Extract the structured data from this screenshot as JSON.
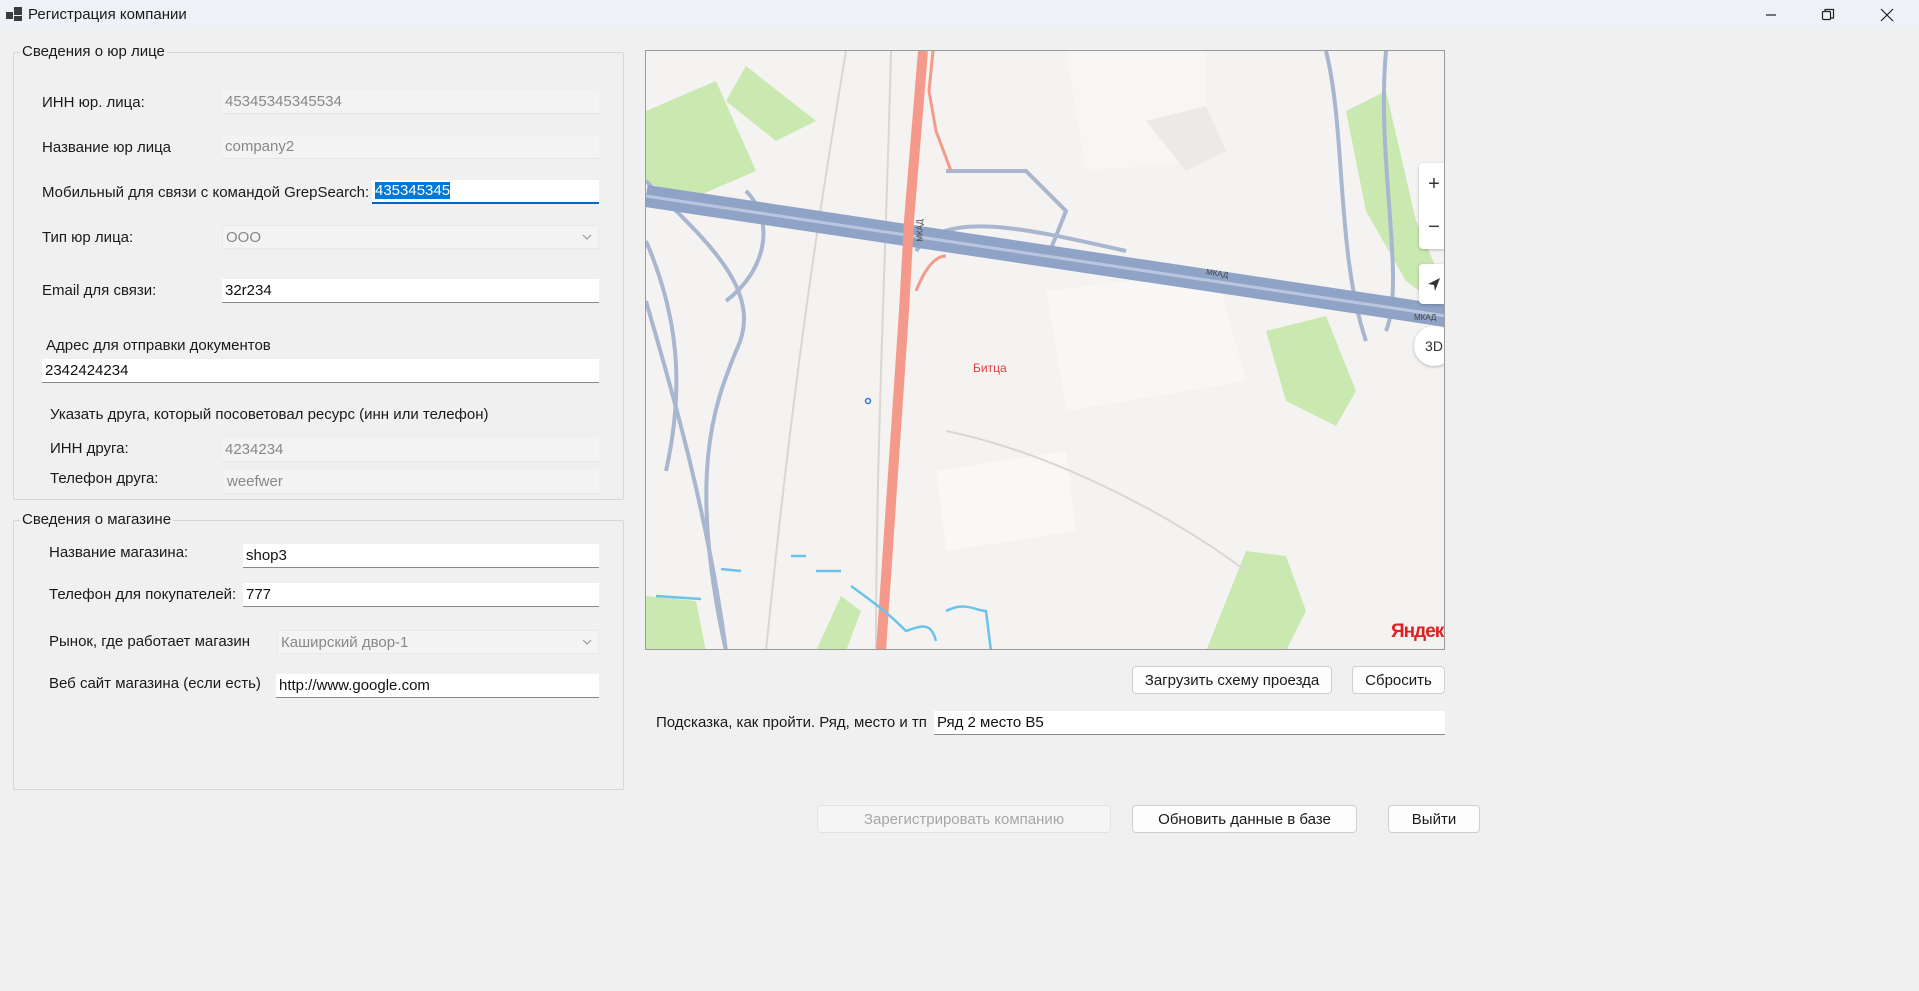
{
  "window": {
    "title": "Регистрация компании",
    "controls": [
      "minimize",
      "restore",
      "close"
    ]
  },
  "legal": {
    "group_title": "Сведения о юр лице",
    "inn_label": "ИНН юр. лица:",
    "inn_value": "45345345345534",
    "name_label": "Название юр лица",
    "name_value": "company2",
    "mobile_label": "Мобильный для связи с командой GrepSearch:",
    "mobile_value": "435345345",
    "type_label": "Тип юр лица:",
    "type_value": "ООО",
    "email_label": "Email для связи:",
    "email_value": "32r234",
    "address_label": "Адрес для отправки документов",
    "address_value": "2342424234",
    "friend_hint": "Указать друга, который посоветовал ресурс (инн или телефон)",
    "friend_inn_label": "ИНН друга:",
    "friend_inn_value": "4234234",
    "friend_phone_label": "Телефон друга:",
    "friend_phone_value": "weefwer"
  },
  "shop": {
    "group_title": "Сведения о магазине",
    "name_label": "Название магазина:",
    "name_value": "shop3",
    "phone_label": "Телефон для покупателей:",
    "phone_value": "777",
    "market_label": "Рынок, где работает магазин",
    "market_value": "Каширский двор-1",
    "site_label": "Веб сайт магазина (если есть)",
    "site_value": "http://www.google.com"
  },
  "map": {
    "place_label": "Битца",
    "road_label_1": "МКАД",
    "road_label_2": "МКАД",
    "road_label_3": "МКАД",
    "zoom_in": "+",
    "zoom_out": "−",
    "mode_3d": "3D",
    "provider_logo": "Яндекс",
    "colors": {
      "ground": "#f4f3f1",
      "park": "#c9e9b0",
      "highway": "#8fa3c7",
      "main_road": "#f59a8a",
      "water": "#6cc3ea"
    }
  },
  "map_actions": {
    "upload_label": "Загрузить схему проезда",
    "reset_label": "Сбросить",
    "hint_label": "Подсказка, как пройти. Ряд, место и тп",
    "hint_value": "Ряд 2 место В5"
  },
  "footer": {
    "register_label": "Зарегистрировать компанию",
    "update_label": "Обновить данные в базе",
    "exit_label": "Выйти"
  }
}
